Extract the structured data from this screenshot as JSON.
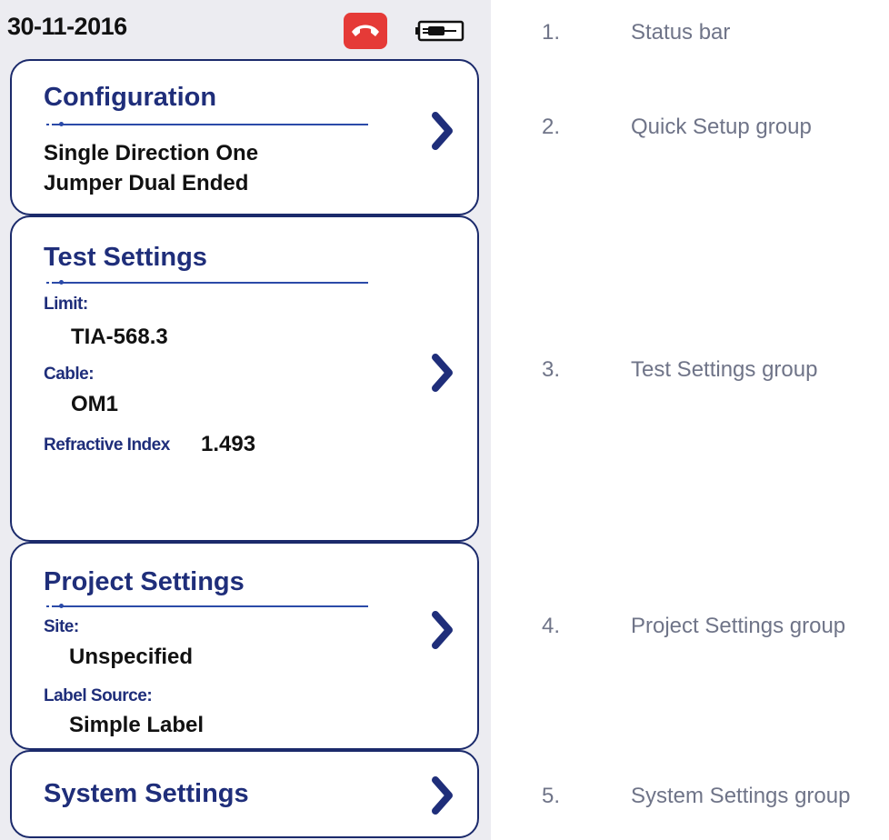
{
  "status_bar": {
    "date": "30-11-2016",
    "phone_icon": "hang-up-phone-icon",
    "battery_icon": "ac-power-battery-icon",
    "phone_color": "#e53a37"
  },
  "configuration": {
    "title": "Configuration",
    "value_line1": "Single Direction One",
    "value_line2": "Jumper Dual Ended"
  },
  "test_settings": {
    "title": "Test Settings",
    "limit_label": "Limit:",
    "limit_value": "TIA-568.3",
    "cable_label": "Cable:",
    "cable_value": "OM1",
    "refractive_label": "Refractive Index",
    "refractive_value": "1.493"
  },
  "project_settings": {
    "title": "Project Settings",
    "site_label": "Site:",
    "site_value": "Unspecified",
    "label_source_label": "Label Source:",
    "label_source_value": "Simple Label"
  },
  "system_settings": {
    "title": "System Settings"
  },
  "legend": [
    {
      "num": "1.",
      "text": "Status bar"
    },
    {
      "num": "2.",
      "text": "Quick Setup group"
    },
    {
      "num": "3.",
      "text": "Test Settings group"
    },
    {
      "num": "4.",
      "text": "Project Settings group"
    },
    {
      "num": "5.",
      "text": "System Settings group"
    }
  ],
  "colors": {
    "title_blue": "#1f2e7a",
    "card_border": "#1b2a6b",
    "chevron": "#1f2e7a",
    "legend_text": "#6f7488"
  }
}
